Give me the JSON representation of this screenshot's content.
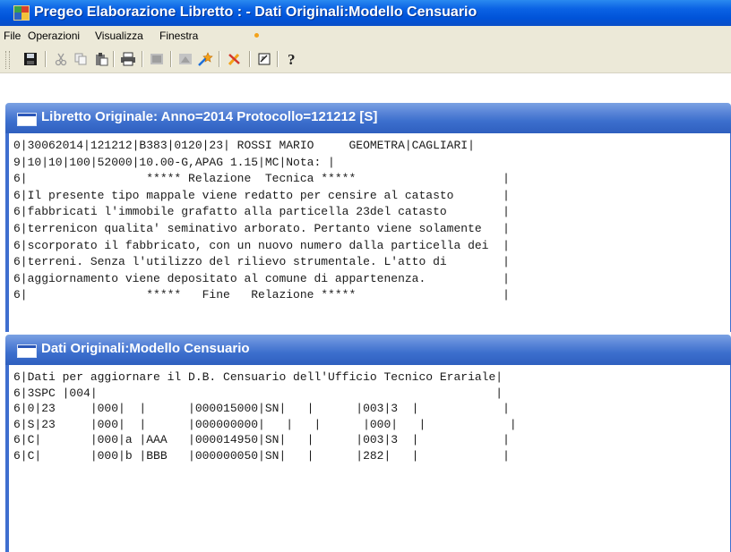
{
  "app": {
    "title": "Pregeo Elaborazione Libretto : - Dati Originali:Modello Censuario"
  },
  "menu": {
    "items": [
      "File",
      "Operazioni",
      "Visualizza",
      "Finestra"
    ]
  },
  "toolbar": {
    "icons": [
      "save-icon",
      "cut-icon",
      "copy-icon",
      "paste-icon",
      "print-icon",
      "disabled-tool-icon",
      "disabled-tool-icon",
      "magic-tool-icon",
      "wrench-tool-icon",
      "edit-icon",
      "help-icon"
    ]
  },
  "windows": [
    {
      "title": "Libretto Originale: Anno=2014 Protocollo=121212 [S]",
      "lines": [
        "0|30062014|121212|B383|0120|23| ROSSI MARIO     GEOMETRA|CAGLIARI|",
        "9|10|10|100|52000|10.00-G,APAG 1.15|MC|Nota: |",
        "6|                 ***** Relazione  Tecnica *****                     |",
        "6|Il presente tipo mappale viene redatto per censire al catasto       |",
        "6|fabbricati l'immobile grafatto alla particella 23del catasto        |",
        "6|terrenicon qualita' seminativo arborato. Pertanto viene solamente   |",
        "6|scorporato il fabbricato, con un nuovo numero dalla particella dei  |",
        "6|terreni. Senza l'utilizzo del rilievo strumentale. L'atto di        |",
        "6|aggiornamento viene depositato al comune di appartenenza.           |",
        "6|                 *****   Fine   Relazione *****                     |"
      ]
    },
    {
      "title": "Dati Originali:Modello Censuario",
      "lines": [
        "6|Dati per aggiornare il D.B. Censuario dell'Ufficio Tecnico Erariale|",
        "6|3SPC |004|                                                         |",
        "6|0|23     |000|  |      |000015000|SN|   |      |003|3  |            |",
        "6|S|23     |000|  |      |000000000|   |   |      |000|   |            |",
        "6|C|       |000|a |AAA   |000014950|SN|   |      |003|3  |            |",
        "6|C|       |000|b |BBB   |000000050|SN|   |      |282|   |            |"
      ]
    }
  ]
}
